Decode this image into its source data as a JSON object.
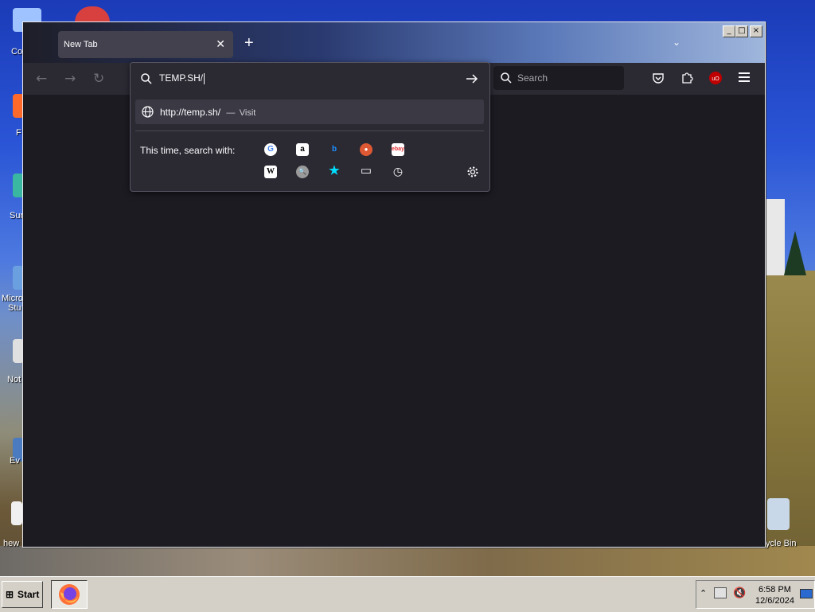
{
  "desktop": {
    "icons": [
      {
        "label": "Co"
      },
      {
        "label": "F"
      },
      {
        "label": "Sur"
      },
      {
        "label": "Micro"
      },
      {
        "label": "Stu"
      },
      {
        "label": "Not"
      },
      {
        "label": "Ev"
      },
      {
        "label": "hew"
      },
      {
        "label": "ycle Bin"
      }
    ]
  },
  "browser": {
    "tab_title": "New Tab",
    "url_input_value": "TEMP.SH/",
    "suggestion_url": "http://temp.sh/",
    "suggestion_separator": "—",
    "suggestion_action": "Visit",
    "search_with_label": "This time, search with:",
    "search_placeholder": "Search",
    "engines": [
      {
        "name": "google-engine-icon",
        "glyph": "G"
      },
      {
        "name": "amazon-engine-icon",
        "glyph": "a"
      },
      {
        "name": "bing-engine-icon",
        "glyph": "b"
      },
      {
        "name": "duckduckgo-engine-icon",
        "glyph": "●"
      },
      {
        "name": "ebay-engine-icon",
        "glyph": "ebay"
      },
      {
        "name": "wikipedia-engine-icon",
        "glyph": "W"
      },
      {
        "name": "search-engine-icon",
        "glyph": "🔍"
      },
      {
        "name": "bookmarks-icon",
        "glyph": "★"
      },
      {
        "name": "tabs-icon",
        "glyph": "▭"
      },
      {
        "name": "history-icon",
        "glyph": "◷"
      }
    ],
    "colors": {
      "toolbar": "#2b2a33",
      "content": "#1c1b22",
      "accent_blue": "#00ddff",
      "ublock_red": "#c00000"
    }
  },
  "window_controls": {
    "minimize": "_",
    "maximize": "□",
    "close": "×"
  },
  "taskbar": {
    "start_label": "Start",
    "time": "6:58 PM",
    "date": "12/6/2024"
  }
}
